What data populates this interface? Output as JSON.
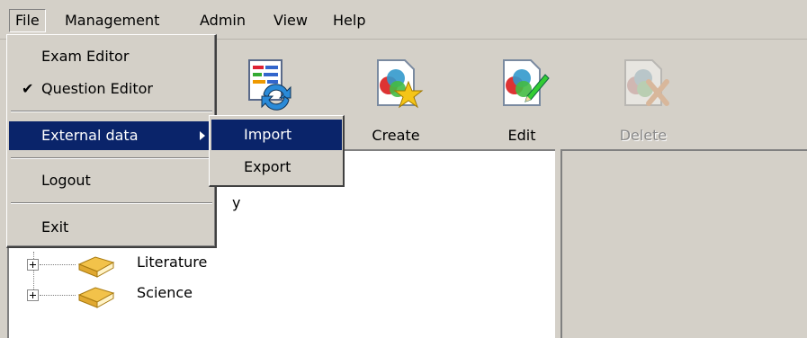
{
  "menubar": {
    "items": [
      "File",
      "Management",
      "Admin",
      "View",
      "Help"
    ]
  },
  "toolbar": {
    "buttons": [
      {
        "label": "",
        "icon": "refresh-list-icon"
      },
      {
        "label": "Create",
        "icon": "create-star-icon"
      },
      {
        "label": "Edit",
        "icon": "edit-pencil-icon"
      },
      {
        "label": "Delete",
        "icon": "delete-x-icon",
        "disabled": true
      }
    ]
  },
  "file_menu": {
    "items": [
      {
        "label": "Exam Editor"
      },
      {
        "label": "Question Editor",
        "checked": true
      },
      {
        "label": "External data",
        "highlighted": true,
        "has_submenu": true
      },
      {
        "label": "Logout"
      },
      {
        "label": "Exit"
      }
    ],
    "check_glyph": "✔"
  },
  "external_submenu": {
    "items": [
      {
        "label": "Import",
        "highlighted": true
      },
      {
        "label": "Export"
      }
    ]
  },
  "tree": {
    "partial_label": "y",
    "items": [
      {
        "label": "Literature"
      },
      {
        "label": "Science"
      }
    ]
  },
  "colors": {
    "face": "#d4d0c8",
    "highlight": "#0a246a",
    "disabled_text": "#8a8a8a"
  }
}
